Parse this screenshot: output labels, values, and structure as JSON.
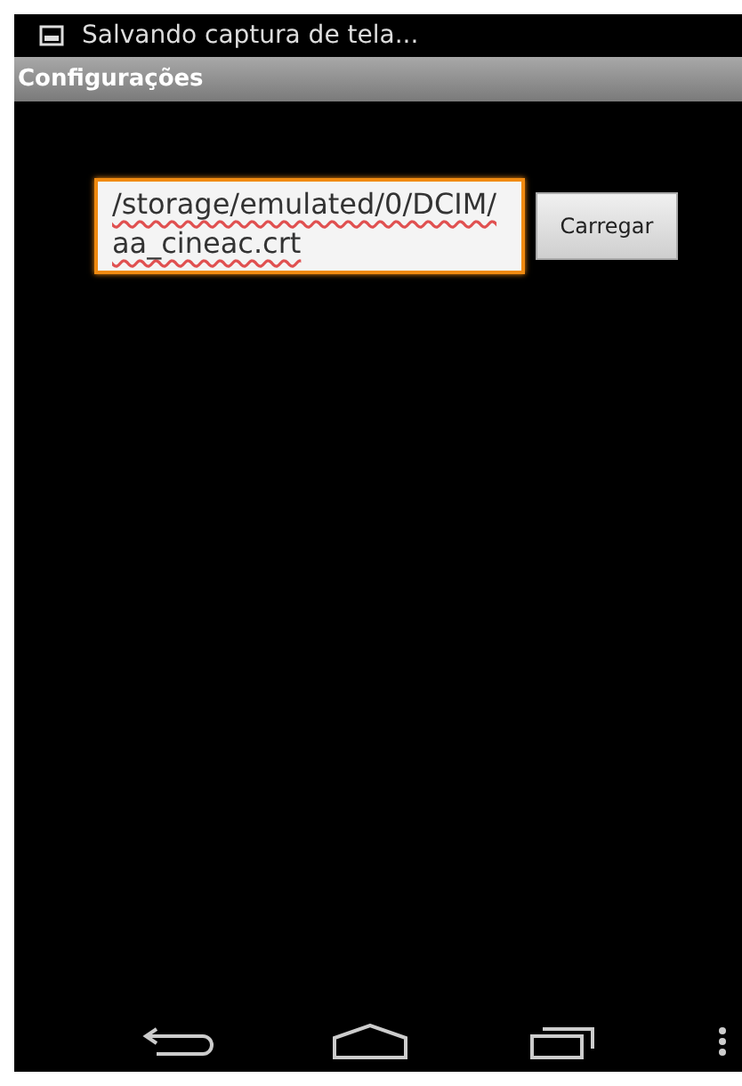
{
  "status_bar": {
    "notification": "Salvando captura de tela..."
  },
  "title_bar": {
    "title": "Configurações"
  },
  "path_field": {
    "value": "/storage/emulated/0/DCIM/aa_cineac.crt",
    "focused": true
  },
  "load_button": {
    "label": "Carregar"
  }
}
